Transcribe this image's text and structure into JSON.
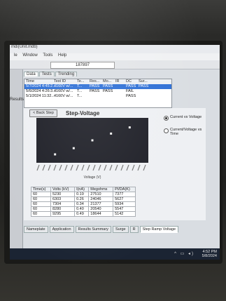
{
  "window": {
    "title": "mdi(Unit.mdb)",
    "menu": [
      "le",
      "Window",
      "Tools",
      "Help"
    ],
    "serial": "187897"
  },
  "left_pane": {
    "tab": "Results"
  },
  "tabs": [
    {
      "label": "Data",
      "active": true
    },
    {
      "label": "Tests",
      "active": false
    },
    {
      "label": "Trending",
      "active": false
    }
  ],
  "results_grid": {
    "headers": [
      "Time",
      "Test ID",
      "Te...",
      "Res...",
      "Mo...",
      "IR",
      "DC",
      "Sur..."
    ],
    "rows": [
      [
        "5/7/2024 4:45:2...",
        "4160V w/...",
        "T...",
        "PASS",
        "PASS",
        "",
        "PASS",
        "PASS"
      ],
      [
        "5/6/2024 4:26:3...",
        "4160V w/...",
        "T...",
        "PASS",
        "PASS",
        "",
        "FAIL",
        ""
      ],
      [
        "5/1/2024 11:32...",
        "4160V w/...",
        "T...",
        "",
        "",
        "",
        "PASS",
        ""
      ]
    ]
  },
  "chart_panel": {
    "back_button": "< Back Step",
    "title": "Step-Voltage",
    "options": [
      {
        "label": "Current vs Voltage",
        "selected": true
      },
      {
        "label": "Current/Voltage vs Time",
        "selected": false
      }
    ]
  },
  "chart_data": {
    "type": "scatter",
    "title": "Step-Voltage",
    "xlabel": "Voltage (V)",
    "ylabel": "",
    "grid": false,
    "series": [
      {
        "values": [
          {
            "x": 1,
            "y": 0.15
          },
          {
            "x": 2,
            "y": 0.26
          },
          {
            "x": 3,
            "y": 0.4
          },
          {
            "x": 4,
            "y": 0.52
          },
          {
            "x": 5,
            "y": 0.63
          }
        ]
      }
    ],
    "ylim": [
      0,
      0.8
    ],
    "xlim": [
      0,
      6
    ]
  },
  "data_table": {
    "headers": [
      "Time(s)",
      "Volts (kV)",
      "I(nA)",
      "Megohms",
      "PI/DA(K)"
    ],
    "rows": [
      [
        "60",
        "5230",
        "0.19",
        "27510",
        "7377"
      ],
      [
        "60",
        "6303",
        "0.26",
        "24046",
        "5627"
      ],
      [
        "60",
        "7304",
        "0.34",
        "21377",
        "5934"
      ],
      [
        "60",
        "8280",
        "0.40",
        "20540",
        "5547"
      ],
      [
        "60",
        "9295",
        "0.49",
        "18644",
        "5142"
      ]
    ]
  },
  "bottom_tabs": [
    {
      "label": "Nameplate",
      "active": false
    },
    {
      "label": "Application",
      "active": false
    },
    {
      "label": "Results Summary",
      "active": false
    },
    {
      "label": "Surge",
      "active": false
    },
    {
      "label": "R",
      "active": false
    },
    {
      "label": "Step Ramp Voltage",
      "active": true
    }
  ],
  "taskbar": {
    "time": "4:52 PM",
    "date": "5/8/2024"
  }
}
